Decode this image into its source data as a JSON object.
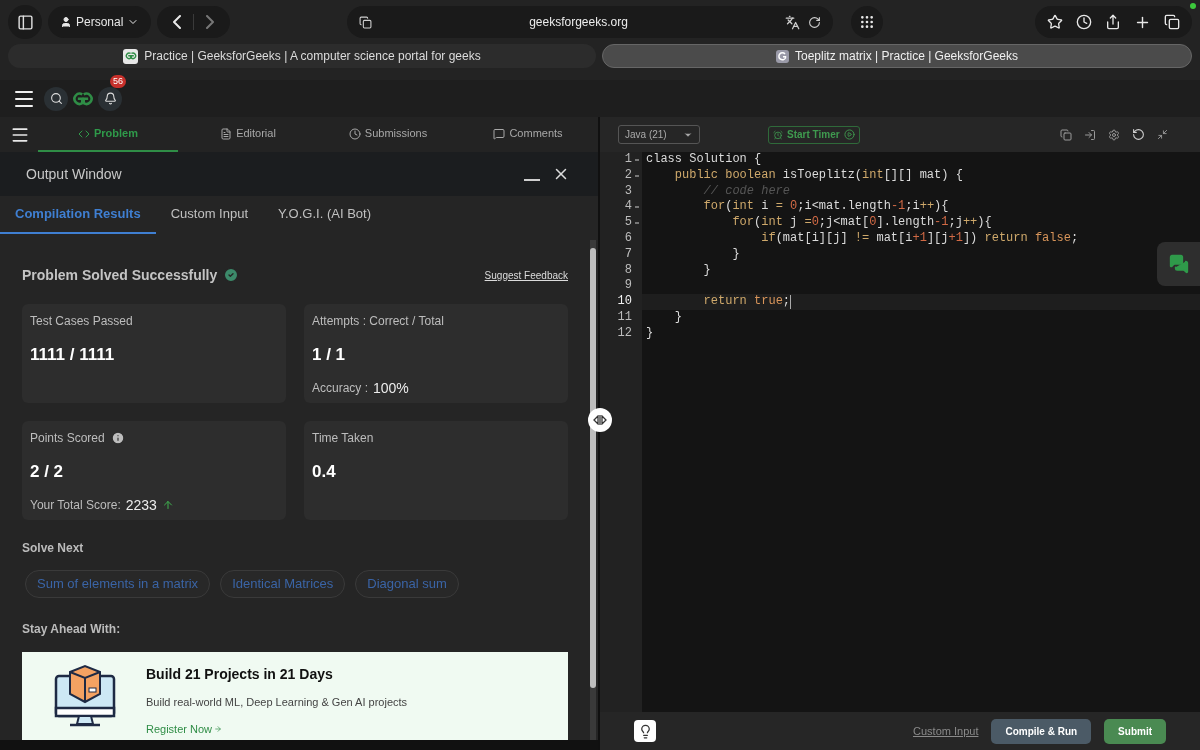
{
  "browser": {
    "profile": "Personal",
    "url": "geeksforgeeks.org",
    "tabs": [
      {
        "title": "Practice | GeeksforGeeks | A computer science portal for geeks",
        "selected": false
      },
      {
        "title": "Toeplitz matrix | Practice | GeeksforGeeks",
        "selected": true
      }
    ]
  },
  "site_header": {
    "notification_count": "56"
  },
  "problem_tabs": [
    {
      "label": "Problem",
      "selected": true,
      "kind": "code"
    },
    {
      "label": "Editorial",
      "selected": false,
      "kind": "doc"
    },
    {
      "label": "Submissions",
      "selected": false,
      "kind": "clock"
    },
    {
      "label": "Comments",
      "selected": false,
      "kind": "chat"
    }
  ],
  "output_window": {
    "title": "Output Window",
    "tabs": [
      {
        "label": "Compilation Results",
        "selected": true
      },
      {
        "label": "Custom Input",
        "selected": false
      },
      {
        "label": "Y.O.G.I. (AI Bot)",
        "selected": false
      }
    ],
    "status": "Problem Solved Successfully",
    "feedback_link": "Suggest Feedback",
    "stats": [
      {
        "label": "Test Cases Passed",
        "value": "1111 / 1111",
        "has_info": false
      },
      {
        "label": "Attempts : Correct / Total",
        "value": "1 / 1",
        "has_info": false,
        "detail_label": "Accuracy :",
        "detail_value": "100%",
        "trend_up": false
      },
      {
        "label": "Points Scored",
        "value": "2 / 2",
        "has_info": true,
        "detail_label": "Your Total Score:",
        "detail_value": "2233",
        "trend_up": true
      },
      {
        "label": "Time Taken",
        "value": "0.4",
        "has_info": false
      }
    ],
    "solve_next": {
      "heading": "Solve Next",
      "items": [
        "Sum of elements in a matrix",
        "Identical Matrices",
        "Diagonal sum"
      ]
    },
    "promo": {
      "heading": "Stay Ahead With:",
      "title": "Build 21 Projects in 21 Days",
      "subtitle": "Build real-world ML, Deep Learning & Gen AI projects",
      "link": "Register Now"
    }
  },
  "editor": {
    "language": "Java (21)",
    "timer_button": "Start Timer",
    "lines": [
      {
        "number": "1",
        "foldable": true,
        "active": false,
        "tokens": [
          {
            "text": "class Solution {",
            "kind": "plain"
          }
        ]
      },
      {
        "number": "2",
        "foldable": true,
        "active": false,
        "tokens": [
          {
            "text": "    public boolean",
            "kind": "kw"
          },
          {
            "text": " isToeplitz(",
            "kind": "plain"
          },
          {
            "text": "int",
            "kind": "kw"
          },
          {
            "text": "[][] mat) {",
            "kind": "plain"
          }
        ]
      },
      {
        "number": "3",
        "foldable": false,
        "active": false,
        "tokens": [
          {
            "text": "        // code here",
            "kind": "comment"
          }
        ]
      },
      {
        "number": "4",
        "foldable": true,
        "active": false,
        "tokens": [
          {
            "text": "        for",
            "kind": "kw"
          },
          {
            "text": "(",
            "kind": "plain"
          },
          {
            "text": "int",
            "kind": "kw"
          },
          {
            "text": " i ",
            "kind": "plain"
          },
          {
            "text": "= ",
            "kind": "kw"
          },
          {
            "text": "0",
            "kind": "num"
          },
          {
            "text": ";i<mat.length",
            "kind": "plain"
          },
          {
            "text": "-1",
            "kind": "num"
          },
          {
            "text": ";i",
            "kind": "plain"
          },
          {
            "text": "++",
            "kind": "kw"
          },
          {
            "text": "){",
            "kind": "plain"
          }
        ]
      },
      {
        "number": "5",
        "foldable": true,
        "active": false,
        "tokens": [
          {
            "text": "            for",
            "kind": "kw"
          },
          {
            "text": "(",
            "kind": "plain"
          },
          {
            "text": "int",
            "kind": "kw"
          },
          {
            "text": " j ",
            "kind": "plain"
          },
          {
            "text": "=",
            "kind": "kw"
          },
          {
            "text": "0",
            "kind": "num"
          },
          {
            "text": ";j<mat[",
            "kind": "plain"
          },
          {
            "text": "0",
            "kind": "num"
          },
          {
            "text": "].length",
            "kind": "plain"
          },
          {
            "text": "-1",
            "kind": "num"
          },
          {
            "text": ";j",
            "kind": "plain"
          },
          {
            "text": "++",
            "kind": "kw"
          },
          {
            "text": "){",
            "kind": "plain"
          }
        ]
      },
      {
        "number": "6",
        "foldable": false,
        "active": false,
        "tokens": [
          {
            "text": "                if",
            "kind": "kw"
          },
          {
            "text": "(mat[i][j] ",
            "kind": "plain"
          },
          {
            "text": "!=",
            "kind": "kw"
          },
          {
            "text": " mat[i",
            "kind": "plain"
          },
          {
            "text": "+1",
            "kind": "num"
          },
          {
            "text": "][j",
            "kind": "plain"
          },
          {
            "text": "+1",
            "kind": "num"
          },
          {
            "text": "]) ",
            "kind": "plain"
          },
          {
            "text": "return ",
            "kind": "kw"
          },
          {
            "text": "false",
            "kind": "lit"
          },
          {
            "text": ";",
            "kind": "plain"
          }
        ]
      },
      {
        "number": "7",
        "foldable": false,
        "active": false,
        "tokens": [
          {
            "text": "            }",
            "kind": "plain"
          }
        ]
      },
      {
        "number": "8",
        "foldable": false,
        "active": false,
        "tokens": [
          {
            "text": "        }",
            "kind": "plain"
          }
        ]
      },
      {
        "number": "9",
        "foldable": false,
        "active": false
      },
      {
        "number": "10",
        "foldable": false,
        "active": true,
        "tokens": [
          {
            "text": "        return ",
            "kind": "kw"
          },
          {
            "text": "true",
            "kind": "lit"
          },
          {
            "text": ";",
            "kind": "plain"
          }
        ]
      },
      {
        "number": "11",
        "foldable": false,
        "active": false,
        "tokens": [
          {
            "text": "    }",
            "kind": "plain"
          }
        ]
      },
      {
        "number": "12",
        "foldable": false,
        "active": false,
        "tokens": [
          {
            "text": "}",
            "kind": "plain"
          }
        ]
      }
    ],
    "custom_input_link": "Custom Input",
    "compile_button": "Compile & Run",
    "submit_button": "Submit"
  }
}
